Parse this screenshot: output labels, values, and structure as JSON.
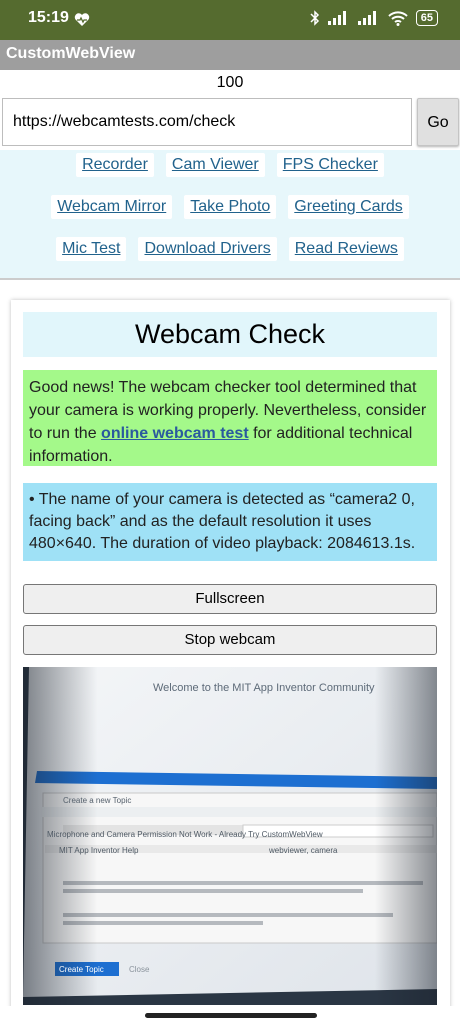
{
  "status": {
    "time": "15:19",
    "battery": "65"
  },
  "app": {
    "title": "CustomWebView"
  },
  "counter": "100",
  "url": {
    "value": "https://webcamtests.com/check"
  },
  "go_label": "Go",
  "nav": [
    [
      "Recorder",
      "Cam Viewer",
      "FPS Checker"
    ],
    [
      "Webcam Mirror",
      "Take Photo",
      "Greeting Cards"
    ],
    [
      "Mic Test",
      "Download Drivers",
      "Read Reviews"
    ]
  ],
  "card": {
    "heading": "Webcam Check",
    "good_before": "Good news! The webcam checker tool determined that your camera is working properly. Nevertheless, consider to run the ",
    "good_link": "online webcam test",
    "good_after": " for additional technical information.",
    "info": "• The name of your camera is detected as “camera2 0, facing back” and as the default resolution it uses 480×640. The duration of video playback: 2084613.1s.",
    "fullscreen": "Fullscreen",
    "stop": "Stop webcam"
  },
  "camera_preview": {
    "title": "Welcome to the MIT App Inventor Community",
    "new_topic": "Create a new Topic",
    "topic": "Microphone and Camera Permission Not Work - Already Try CustomWebView",
    "category": "MIT App Inventor Help",
    "tags": "webviewer, camera",
    "create_btn": "Create Topic",
    "close": "Close"
  },
  "colors": {
    "status_bar": "#556b2f",
    "app_bar": "#9e9e9e",
    "nav_bg": "#e7f7fb",
    "link": "#21628c",
    "good_bg": "#a4f98a",
    "info_bg": "#9fe1f6"
  }
}
